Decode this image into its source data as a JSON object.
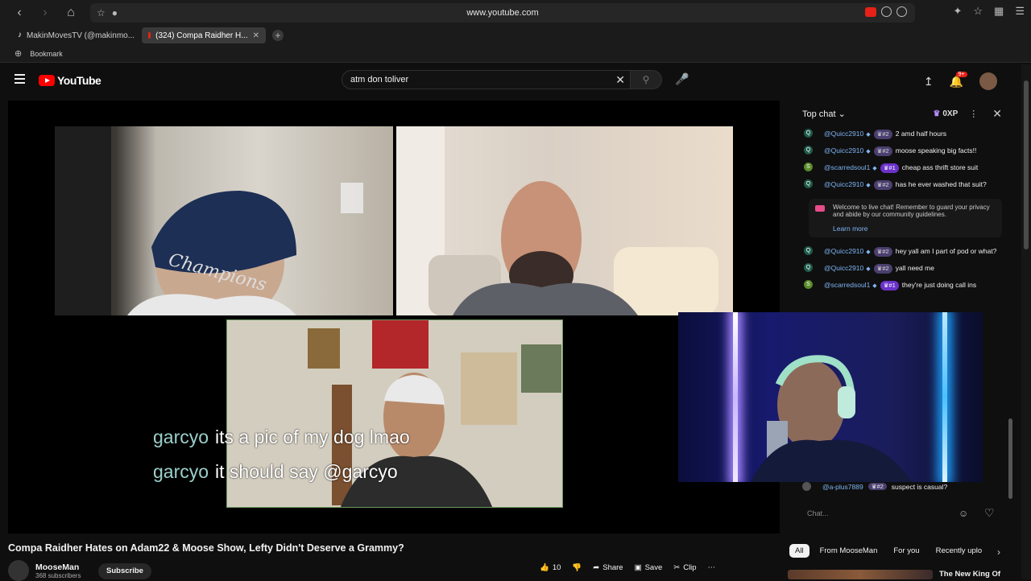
{
  "browser": {
    "url": "www.youtube.com",
    "tabs": [
      {
        "label": "MakinMovesTV (@makinmo...",
        "icon": "tiktok-icon"
      },
      {
        "label": "(324) Compa Raidher H...",
        "icon": "youtube-icon"
      }
    ],
    "bookmark_label": "Bookmark"
  },
  "youtube": {
    "logo_text": "YouTube",
    "search_value": "atm don toliver",
    "notification_badge": "9+"
  },
  "video": {
    "captions": [
      {
        "user": "garcyo",
        "text": "its a pic of my dog lmao"
      },
      {
        "user": "garcyo",
        "text": "it should say @garcyo"
      }
    ],
    "title": "Compa Raidher Hates on Adam22 & Moose Show, Lefty Didn't Deserve a Grammy?",
    "channel": "MooseMan",
    "subscribers": "368 subscribers",
    "subscribe_label": "Subscribe",
    "like_count": "10",
    "share_label": "Share",
    "save_label": "Save",
    "clip_label": "Clip"
  },
  "chat": {
    "header_label": "Top chat",
    "xp_label": "0XP",
    "messages": [
      {
        "avatar": "Q",
        "avatar_color": "#1f5a4a",
        "name": "@Quicc2910",
        "rank": "#2",
        "text": "2 amd half hours"
      },
      {
        "avatar": "Q",
        "avatar_color": "#1f5a4a",
        "name": "@Quicc2910",
        "rank": "#2",
        "text": "moose speaking big facts!!"
      },
      {
        "avatar": "S",
        "avatar_color": "#5a8a2a",
        "name": "@scarredsoul1",
        "rank": "#1",
        "text": "cheap ass thrift store suit"
      },
      {
        "avatar": "Q",
        "avatar_color": "#1f5a4a",
        "name": "@Quicc2910",
        "rank": "#2",
        "text": "has he ever washed that suit?"
      }
    ],
    "welcome_text": "Welcome to live chat! Remember to guard your privacy and abide by our community guidelines.",
    "learn_more": "Learn more",
    "messages2": [
      {
        "avatar": "Q",
        "avatar_color": "#1f5a4a",
        "name": "@Quicc2910",
        "rank": "#2",
        "text": "hey yall am I part of pod or what?"
      },
      {
        "avatar": "Q",
        "avatar_color": "#1f5a4a",
        "name": "@Quicc2910",
        "rank": "#2",
        "text": "yall need me"
      },
      {
        "avatar": "S",
        "avatar_color": "#5a8a2a",
        "name": "@scarredsoul1",
        "rank": "#1",
        "text": "they're just doing call ins"
      }
    ],
    "last_message": {
      "name": "@a-plus7889",
      "rank": "#2",
      "text": "suspect is casual?"
    },
    "input_placeholder": "Chat..."
  },
  "recommendations": {
    "chips": [
      "All",
      "From MooseMan",
      "For you",
      "Recently uplo"
    ],
    "first_title": "The New King Of"
  }
}
